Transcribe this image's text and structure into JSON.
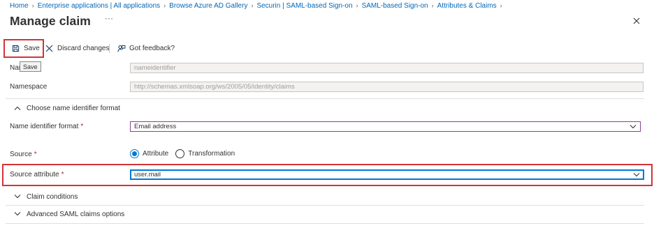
{
  "breadcrumb": [
    "Home",
    "Enterprise applications | All applications",
    "Browse Azure AD Gallery",
    "Securin | SAML-based Sign-on",
    "SAML-based Sign-on",
    "Attributes & Claims"
  ],
  "header": {
    "title": "Manage claim",
    "more": "···"
  },
  "toolbar": {
    "save_label": "Save",
    "discard_label": "Discard changes",
    "feedback_label": "Got feedback?",
    "tooltip": "Save"
  },
  "form": {
    "name_label": "Name",
    "name_value": "nameidentifier",
    "namespace_label": "Namespace",
    "namespace_value": "http://schemas.xmlsoap.org/ws/2005/05/identity/claims",
    "section_name_id": "Choose name identifier format",
    "name_id_format_label": "Name identifier format",
    "name_id_format_value": "Email address",
    "source_label": "Source",
    "source_options": [
      "Attribute",
      "Transformation"
    ],
    "source_selected": "Attribute",
    "source_attribute_label": "Source attribute",
    "source_attribute_value": "user.mail",
    "required_mark": "*",
    "section_conditions": "Claim conditions",
    "section_advanced": "Advanced SAML claims options"
  },
  "colors": {
    "accent": "#0078d4",
    "highlight": "#d13438",
    "link": "#0067b8"
  }
}
